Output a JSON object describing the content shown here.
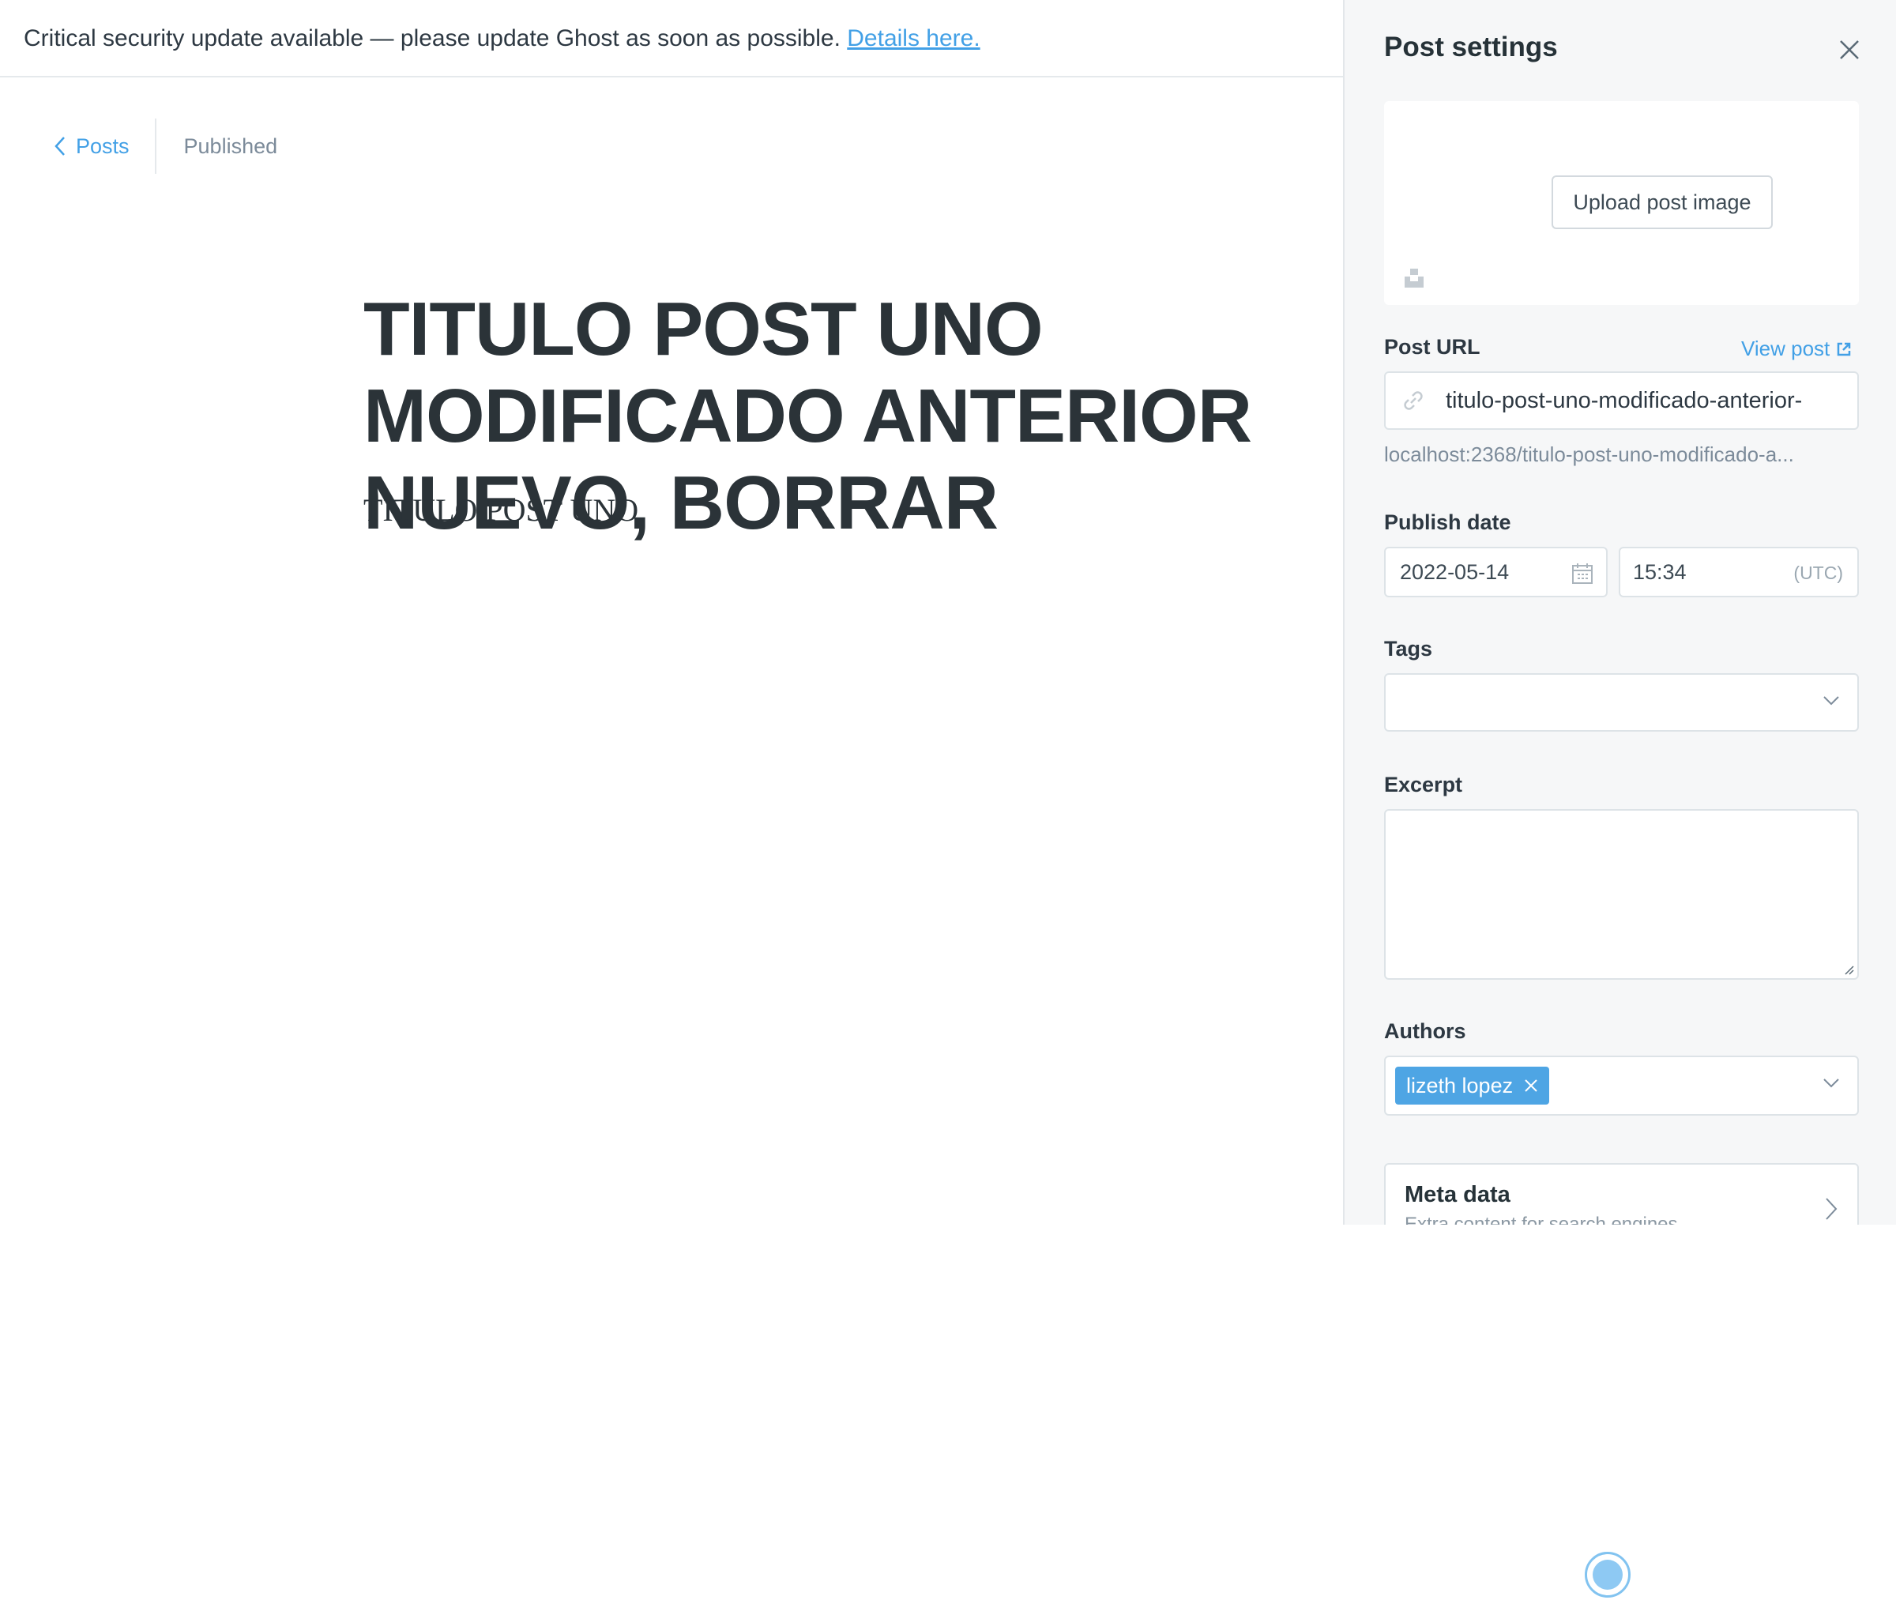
{
  "banner": {
    "message": "Critical security update available — please update Ghost as soon as possible.",
    "link_label": "Details here."
  },
  "nav": {
    "back_label": "Posts",
    "status": "Published"
  },
  "post": {
    "title": "TITULO POST UNO MODIFICADO ANTERIOR NUEVO, BORRAR",
    "body": "TITULO POST UNO"
  },
  "settings": {
    "title": "Post settings",
    "upload_label": "Upload post image",
    "url_label": "Post URL",
    "view_post_label": "View post",
    "slug": "titulo-post-uno-modificado-anterior-",
    "full_url": "localhost:2368/titulo-post-uno-modificado-a...",
    "publish_date_label": "Publish date",
    "date": "2022-05-14",
    "time": "15:34",
    "timezone": "(UTC)",
    "tags_label": "Tags",
    "excerpt_label": "Excerpt",
    "authors_label": "Authors",
    "author": "lizeth lopez",
    "meta_title": "Meta data",
    "meta_subtitle": "Extra content for search engines"
  },
  "colors": {
    "accent": "#42a0e6",
    "chip": "#4ea5e4",
    "panel_bg": "#f6f7f8",
    "title_text": "#2b3338"
  },
  "icons": [
    "chevron-left-icon",
    "close-icon",
    "unsplash-icon",
    "external-link-icon",
    "link-icon",
    "calendar-icon",
    "chevron-down-icon",
    "chevron-right-icon"
  ]
}
